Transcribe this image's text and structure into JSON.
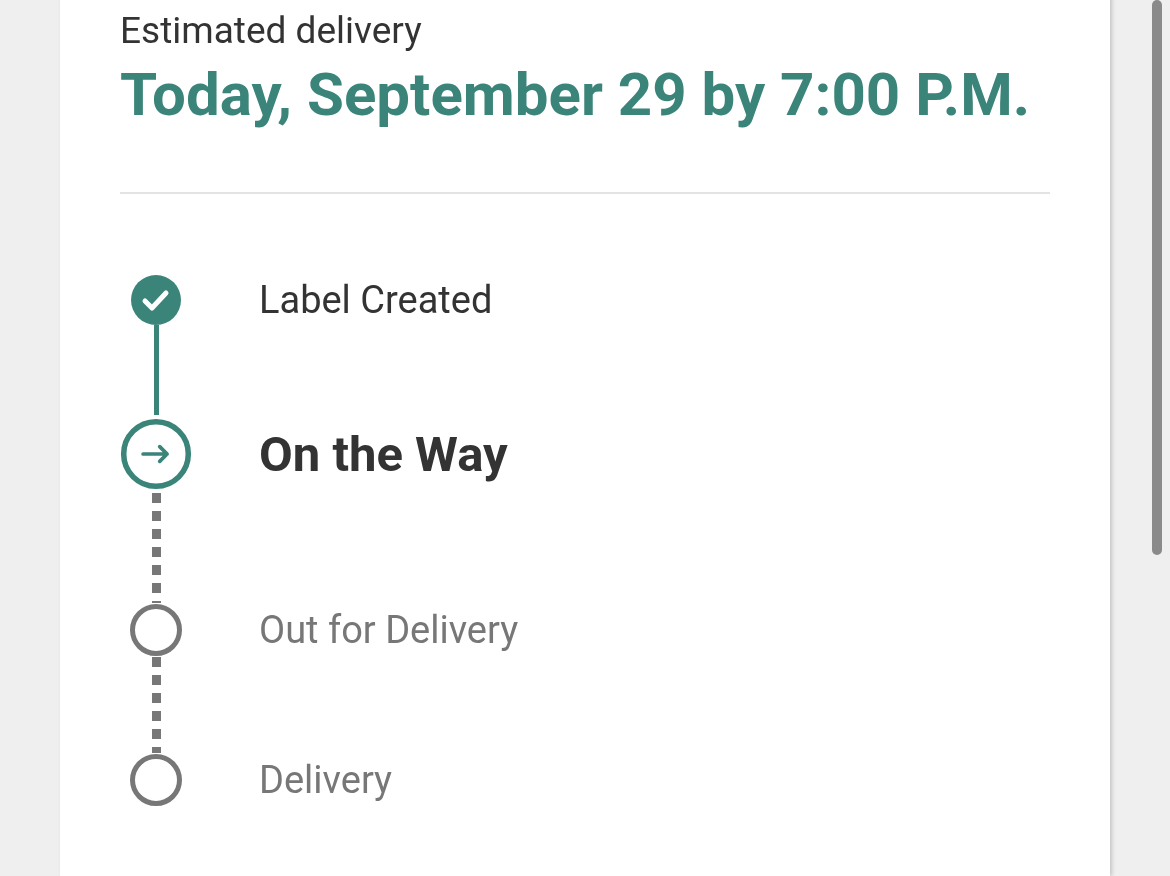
{
  "delivery": {
    "label": "Estimated delivery",
    "date": "Today, September 29 by 7:00 P.M."
  },
  "steps": [
    {
      "label": "Label Created",
      "kind": "done"
    },
    {
      "label": "On the Way",
      "kind": "current"
    },
    {
      "label": "Out for Delivery",
      "kind": "pending"
    },
    {
      "label": "Delivery",
      "kind": "pending"
    }
  ]
}
